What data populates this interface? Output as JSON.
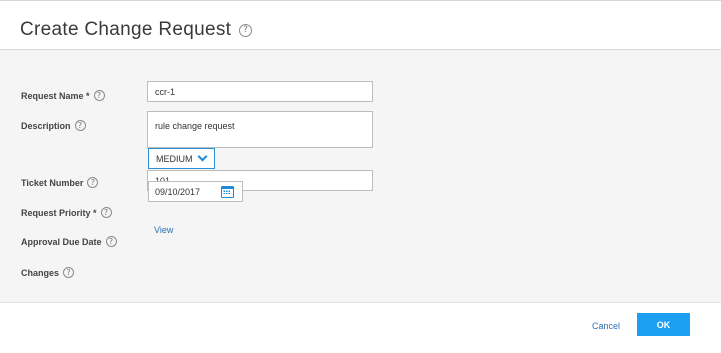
{
  "dialog": {
    "title": "Create Change Request",
    "help_glyph": "?"
  },
  "form": {
    "request_name": {
      "label": "Request Name *",
      "value": "ccr-1",
      "placeholder": ""
    },
    "description": {
      "label": "Description",
      "value": "rule change request"
    },
    "ticket_number": {
      "label": "Ticket Number",
      "value": "101"
    },
    "request_priority": {
      "label": "Request Priority *",
      "value": "MEDIUM"
    },
    "approval_due_date": {
      "label": "Approval Due Date",
      "value": "09/10/2017"
    },
    "changes": {
      "label": "Changes",
      "link": "View"
    }
  },
  "footer": {
    "cancel_label": "Cancel",
    "ok_label": "OK"
  },
  "colors": {
    "accent": "#1a9ff2",
    "link": "#2b6fb8",
    "body_bg": "#f5f5f5"
  },
  "icons": [
    "help-icon",
    "chevron-down-icon",
    "calendar-icon"
  ]
}
